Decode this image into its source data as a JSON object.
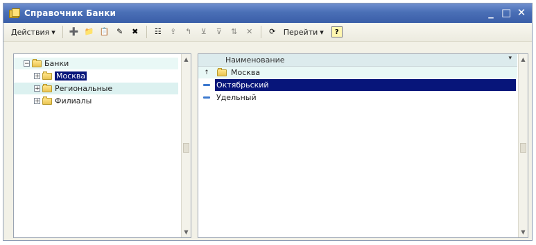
{
  "window": {
    "title": "Справочник Банки",
    "controls": [
      "_",
      "□",
      "✕"
    ]
  },
  "toolbar": {
    "actions_label": "Действия",
    "goto_label": "Перейти",
    "help_label": "?"
  },
  "tree": {
    "root": "Банки",
    "items": [
      "Москва",
      "Региональные",
      "Филиалы"
    ],
    "selected_index": 0
  },
  "grid": {
    "column_header": "Наименование",
    "rows": [
      {
        "name": "Москва",
        "kind": "group",
        "marker": "↑"
      },
      {
        "name": "Октябрьский",
        "kind": "item",
        "selected": true
      },
      {
        "name": "Удельный",
        "kind": "item"
      }
    ]
  },
  "colors": {
    "title_bar": "#4a6fb6",
    "selection": "#07157a",
    "row_alt": "#e9f8f6",
    "window_bg": "#f2f1e7"
  }
}
